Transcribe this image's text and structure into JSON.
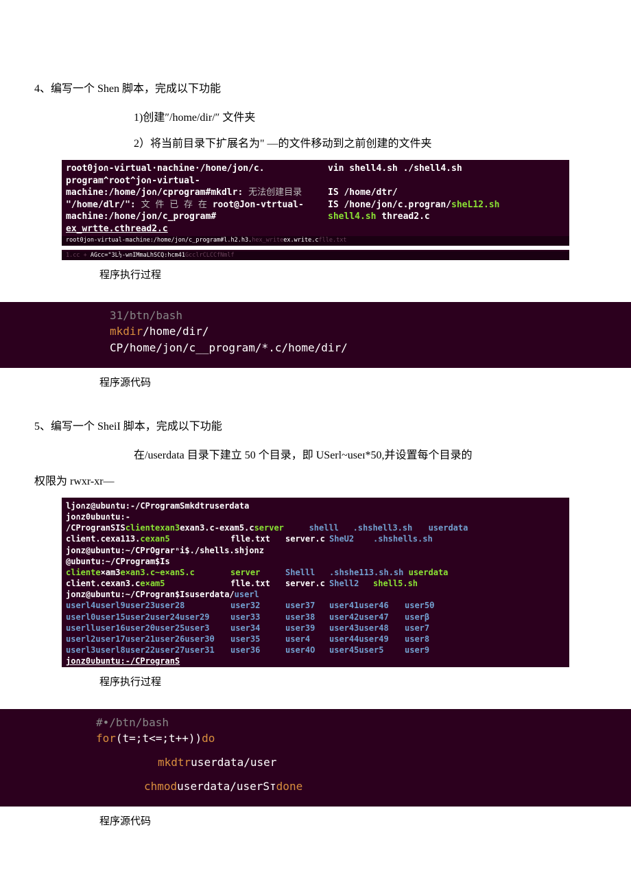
{
  "q4": {
    "title": "4、编写一个 Shen 脚本，完成以下功能",
    "step1": "1)创建″/home/dir/″ 文件夹",
    "step2": "2）将当前目录下扩展名为\" —的文件移动到之前创建的文件夹",
    "term": {
      "l1a": "root0jo∩-virtual·nachine·/hone/jon/c.",
      "l1b": "vin shell4.sh ./shell4.sh",
      "l2a": "program^root^jo∩-virtual-",
      "l3a": "machine:/home/jo∩/cprogram#mkdlr:",
      "l3b": "无法创建目录",
      "l3c": "IS /home/dtr/",
      "l4a": "\"/home/dlr/\":",
      "l4b": "文 件 已 存 在",
      "l4c": "root@Jon-vtrtual-",
      "l4d": "IS /hone/jon/c.progran/",
      "l4e": "sheL12.sh",
      "l5a": "machine:/hone/jon/c_program#",
      "l5b": "shell4.sh ",
      "l5c": "thread2.c",
      "l6a": " ex_wrtte.cthread2.c",
      "tiny1a": "root0jon-virtual-machine:/home/jon/c_program#l.h2.h3.",
      "tiny1b": "hex_write",
      "tiny1c": "ex.write.c",
      "tiny1d": "flle.txt",
      "tiny2a": "1.cc + ",
      "tiny2b": "AGcc=\"3L½-wnIMmaLhSCQ:hcm41",
      "tiny2c": "GcclrCLCCfNmlf"
    },
    "caption1": "程序执行过程",
    "code": {
      "l1": "31/btn/bash",
      "l2a": "mkdir",
      "l2b": "/home/dir/",
      "l3": "CP/home/jon/c__program/*.c/home/dir/"
    },
    "caption2": "程序源代码"
  },
  "q5": {
    "title": "5、编写一个 SheiI 脚本，完成以下功能",
    "desc": "在/userdata 目录下建立 50 个目录，即 USerl~useɪ*50,并设置每个目录的",
    "desc2": "权限为 rwxr-xr—",
    "term": {
      "l1": "ljo∩z@ubu∩tu:-/CProgramSmkdtruserdata",
      "l2": "jo∩z0ubu∩tu:-",
      "l3a": "/CProgranSIS",
      "l3b": "clientexan3",
      "l3c": "exan3.c-exam5.c",
      "l3d": "server",
      "l3e": "shelll",
      "l3f": ".shshell3.sh",
      "l3g": "userdata",
      "l4a": "client.cexa113.",
      "l4b": "cexan5",
      "l4c": "flle.txt",
      "l4d": "server.c",
      "l4e": "SheU2",
      "l4f": ".shshells.sh",
      "l5a": "jonz@ubuntu:~/CPrOgrarⁿi$./shells.shjonz",
      "l6a": "@ubuntu:~/CProgram$Is",
      "l7a": "cliente",
      "l7b": "×am3",
      "l7c": "e×an3.c~e×anS.c",
      "l7d": "server",
      "l7e": "Shelll",
      "l7f": ".shshe113.sh.sh ",
      "l7g": "userdata",
      "l8a": "client.cexan3.c",
      "l8b": "e×am5",
      "l8c": "flle.txt",
      "l8d": "server.c",
      "l8e": "Shell2",
      "l8f": "shell5.sh",
      "l9a": "jonz@ubuntu:~/CProgran$Isuserdata/",
      "l9b": "userl",
      "u1": [
        "userl4userl9user23user28",
        "user32",
        "user37",
        "user41user46",
        "user5θ"
      ],
      "u2": [
        "userl0user15user2user24user29",
        "user33",
        "user38",
        "user42user47",
        "userβ"
      ],
      "u3": [
        "userlluser16user2θuser25user3",
        "user34",
        "user39",
        "user43user48",
        "user7"
      ],
      "u4": [
        "userl2user17user21user26user3θ",
        "user35",
        "user4",
        "user44user49",
        "user8"
      ],
      "u5": [
        "userl3userl8user22user27user31",
        "user36",
        "user4Ο",
        "user45user5",
        "user9"
      ],
      "last": "jo∩z0∪buntu:-/CProgranS"
    },
    "caption1": "程序执行过程",
    "code": {
      "l1": "#•/btn/bash",
      "l2a": "for",
      "l2b": "(t=;t<=;t++))",
      "l2c": "do",
      "l3a": "mkdtr",
      "l3b": "userdata/user",
      "l4a": "chmod",
      "l4b": "userdata/userSт",
      "l4c": "done"
    },
    "caption2": "程序源代码"
  }
}
